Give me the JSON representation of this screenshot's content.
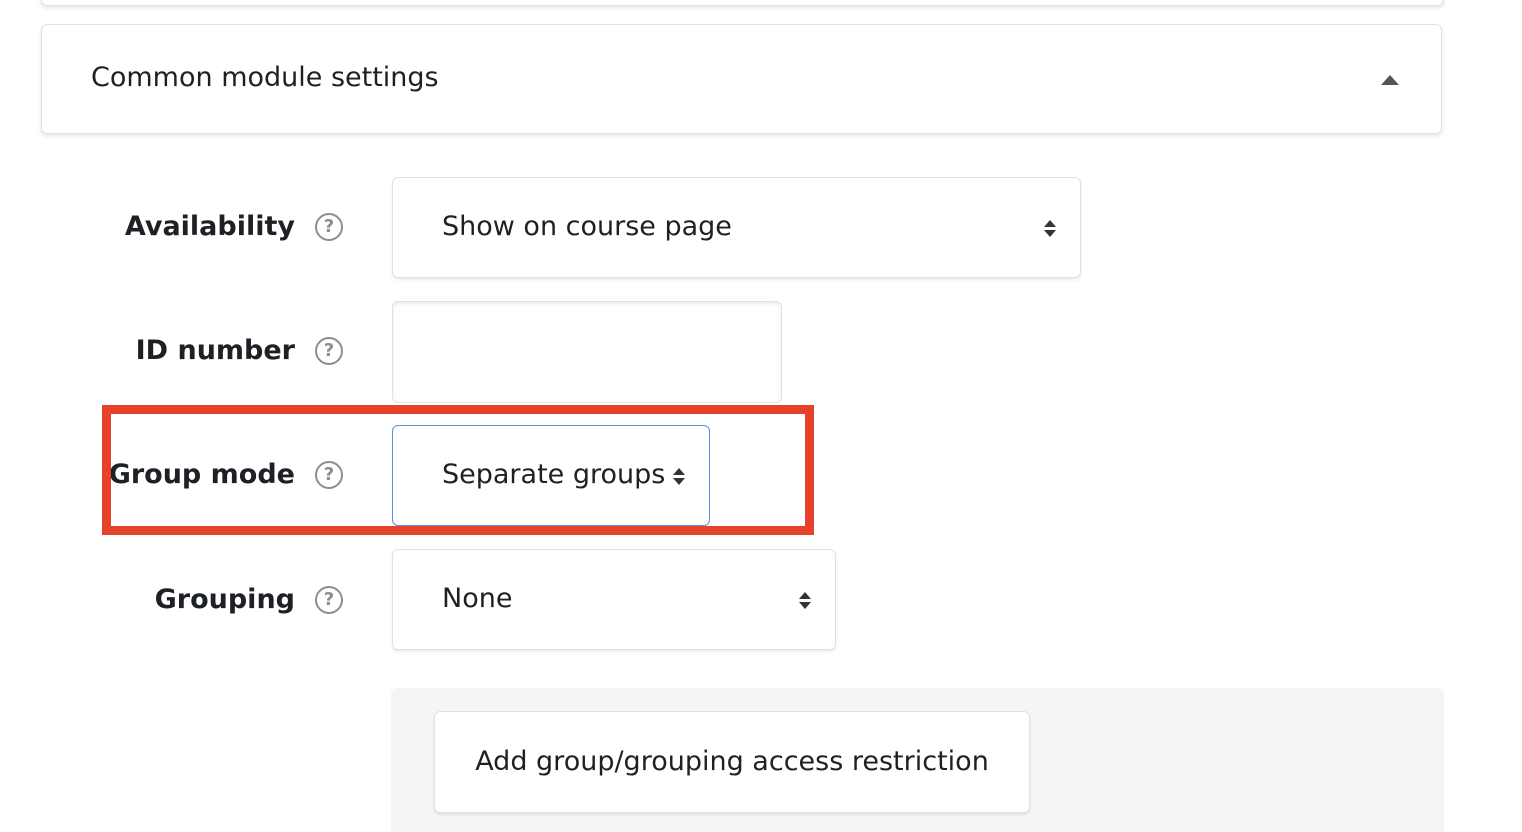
{
  "section": {
    "title": "Common module settings",
    "collapse_icon": "caret-up-icon"
  },
  "fields": {
    "availability": {
      "label": "Availability",
      "help_icon": "question-circle-icon",
      "help_glyph": "?",
      "value": "Show on course page"
    },
    "id_number": {
      "label": "ID number",
      "help_icon": "question-circle-icon",
      "help_glyph": "?",
      "value": ""
    },
    "group_mode": {
      "label": "Group mode",
      "help_icon": "question-circle-icon",
      "help_glyph": "?",
      "value": "Separate groups"
    },
    "grouping": {
      "label": "Grouping",
      "help_icon": "question-circle-icon",
      "help_glyph": "?",
      "value": "None"
    }
  },
  "restriction": {
    "button_label": "Add group/grouping access restriction"
  },
  "colors": {
    "highlight": "#e5412b",
    "focus_border": "#5b8ee6",
    "panel_bg": "#f5f5f5"
  }
}
